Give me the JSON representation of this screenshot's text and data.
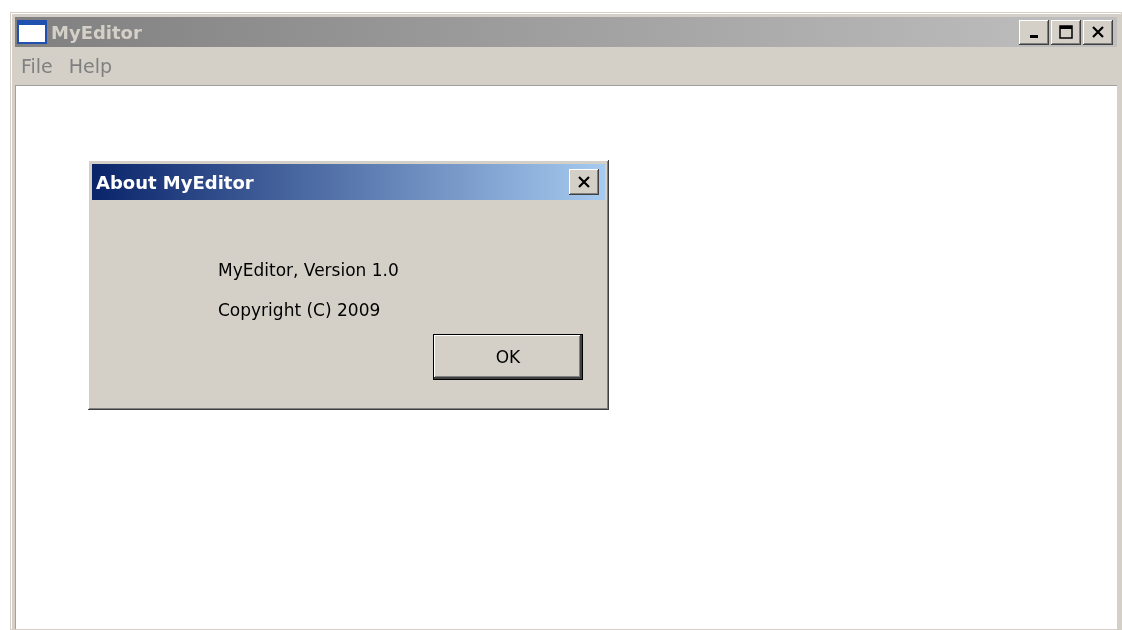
{
  "window": {
    "title": "MyEditor",
    "active": false
  },
  "menu": [
    {
      "label": "File",
      "disabled": true
    },
    {
      "label": "Help",
      "disabled": true
    }
  ],
  "dialog": {
    "title": "About MyEditor",
    "active": true,
    "lines": [
      "MyEditor, Version 1.0",
      "Copyright (C) 2009"
    ],
    "button": "OK"
  }
}
